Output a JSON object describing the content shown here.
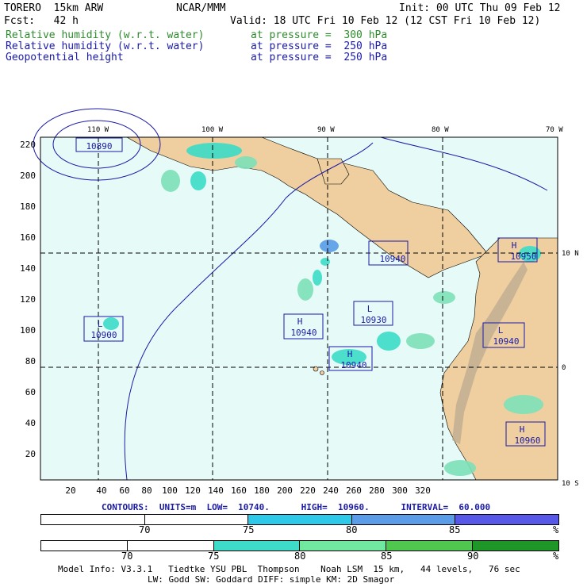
{
  "header": {
    "model": "TORERO  15km ARW",
    "center": "NCAR/MMM",
    "init": "Init: 00 UTC Thu 09 Feb 12",
    "fcst": "Fcst:   42 h",
    "valid": "Valid: 18 UTC Fri 10 Feb 12 (12 CST Fri 10 Feb 12)",
    "fields": [
      {
        "name": "Relative humidity (w.r.t. water)",
        "level": "at pressure =  300 hPa",
        "color": "#2e8b2e"
      },
      {
        "name": "Relative humidity (w.r.t. water)",
        "level": "at pressure =  250 hPa",
        "color": "#1a1aa8"
      },
      {
        "name": "Geopotential height",
        "level": "at pressure =  250 hPa",
        "color": "#1a1aa8"
      }
    ]
  },
  "map": {
    "top_lon_labels": [
      "110 W",
      "100 W",
      "90 W",
      "80 W",
      "70 W"
    ],
    "right_lat_labels": [
      "10 N",
      "0",
      "10 S"
    ],
    "y_ticks": [
      "220",
      "200",
      "180",
      "160",
      "140",
      "120",
      "100",
      "80",
      "60",
      "40",
      "20"
    ],
    "x_ticks": [
      "20",
      "40",
      "60",
      "80",
      "100",
      "120",
      "140",
      "160",
      "180",
      "200",
      "220",
      "240",
      "260",
      "280",
      "300",
      "320"
    ],
    "ocean_color": "#e6fbf8",
    "land_color": "#efcf9f",
    "centers": [
      {
        "type": "",
        "value": "10890"
      },
      {
        "type": "L",
        "value": "10900"
      },
      {
        "type": "H",
        "value": "10940"
      },
      {
        "type": "L",
        "value": "10930"
      },
      {
        "type": "H",
        "value": "10940"
      },
      {
        "type": "",
        "value": "10940"
      },
      {
        "type": "H",
        "value": "10950"
      },
      {
        "type": "L",
        "value": "10940"
      },
      {
        "type": "H",
        "value": "10960"
      }
    ]
  },
  "contours_line": "CONTOURS:  UNITS=m  LOW=  10740.      HIGH=  10960.      INTERVAL=  60.000",
  "scale1": {
    "labels": [
      "70",
      "75",
      "80",
      "85",
      "%"
    ],
    "colors": [
      "#ffffff",
      "#ffffff",
      "#2ec8e8",
      "#5a9ce8",
      "#5858e8"
    ]
  },
  "scale2": {
    "labels": [
      "70",
      "75",
      "80",
      "85",
      "90",
      "%"
    ],
    "colors": [
      "#ffffff",
      "#ffffff",
      "#3cdcc8",
      "#70e8a0",
      "#50c850",
      "#1e9628"
    ]
  },
  "footer": {
    "line1": "Model Info: V3.3.1   Tiedtke YSU PBL  Thompson    Noah LSM  15 km,   44 levels,   76 sec",
    "line2": "LW: Godd SW: Goddard DIFF: simple KM: 2D Smagor"
  }
}
